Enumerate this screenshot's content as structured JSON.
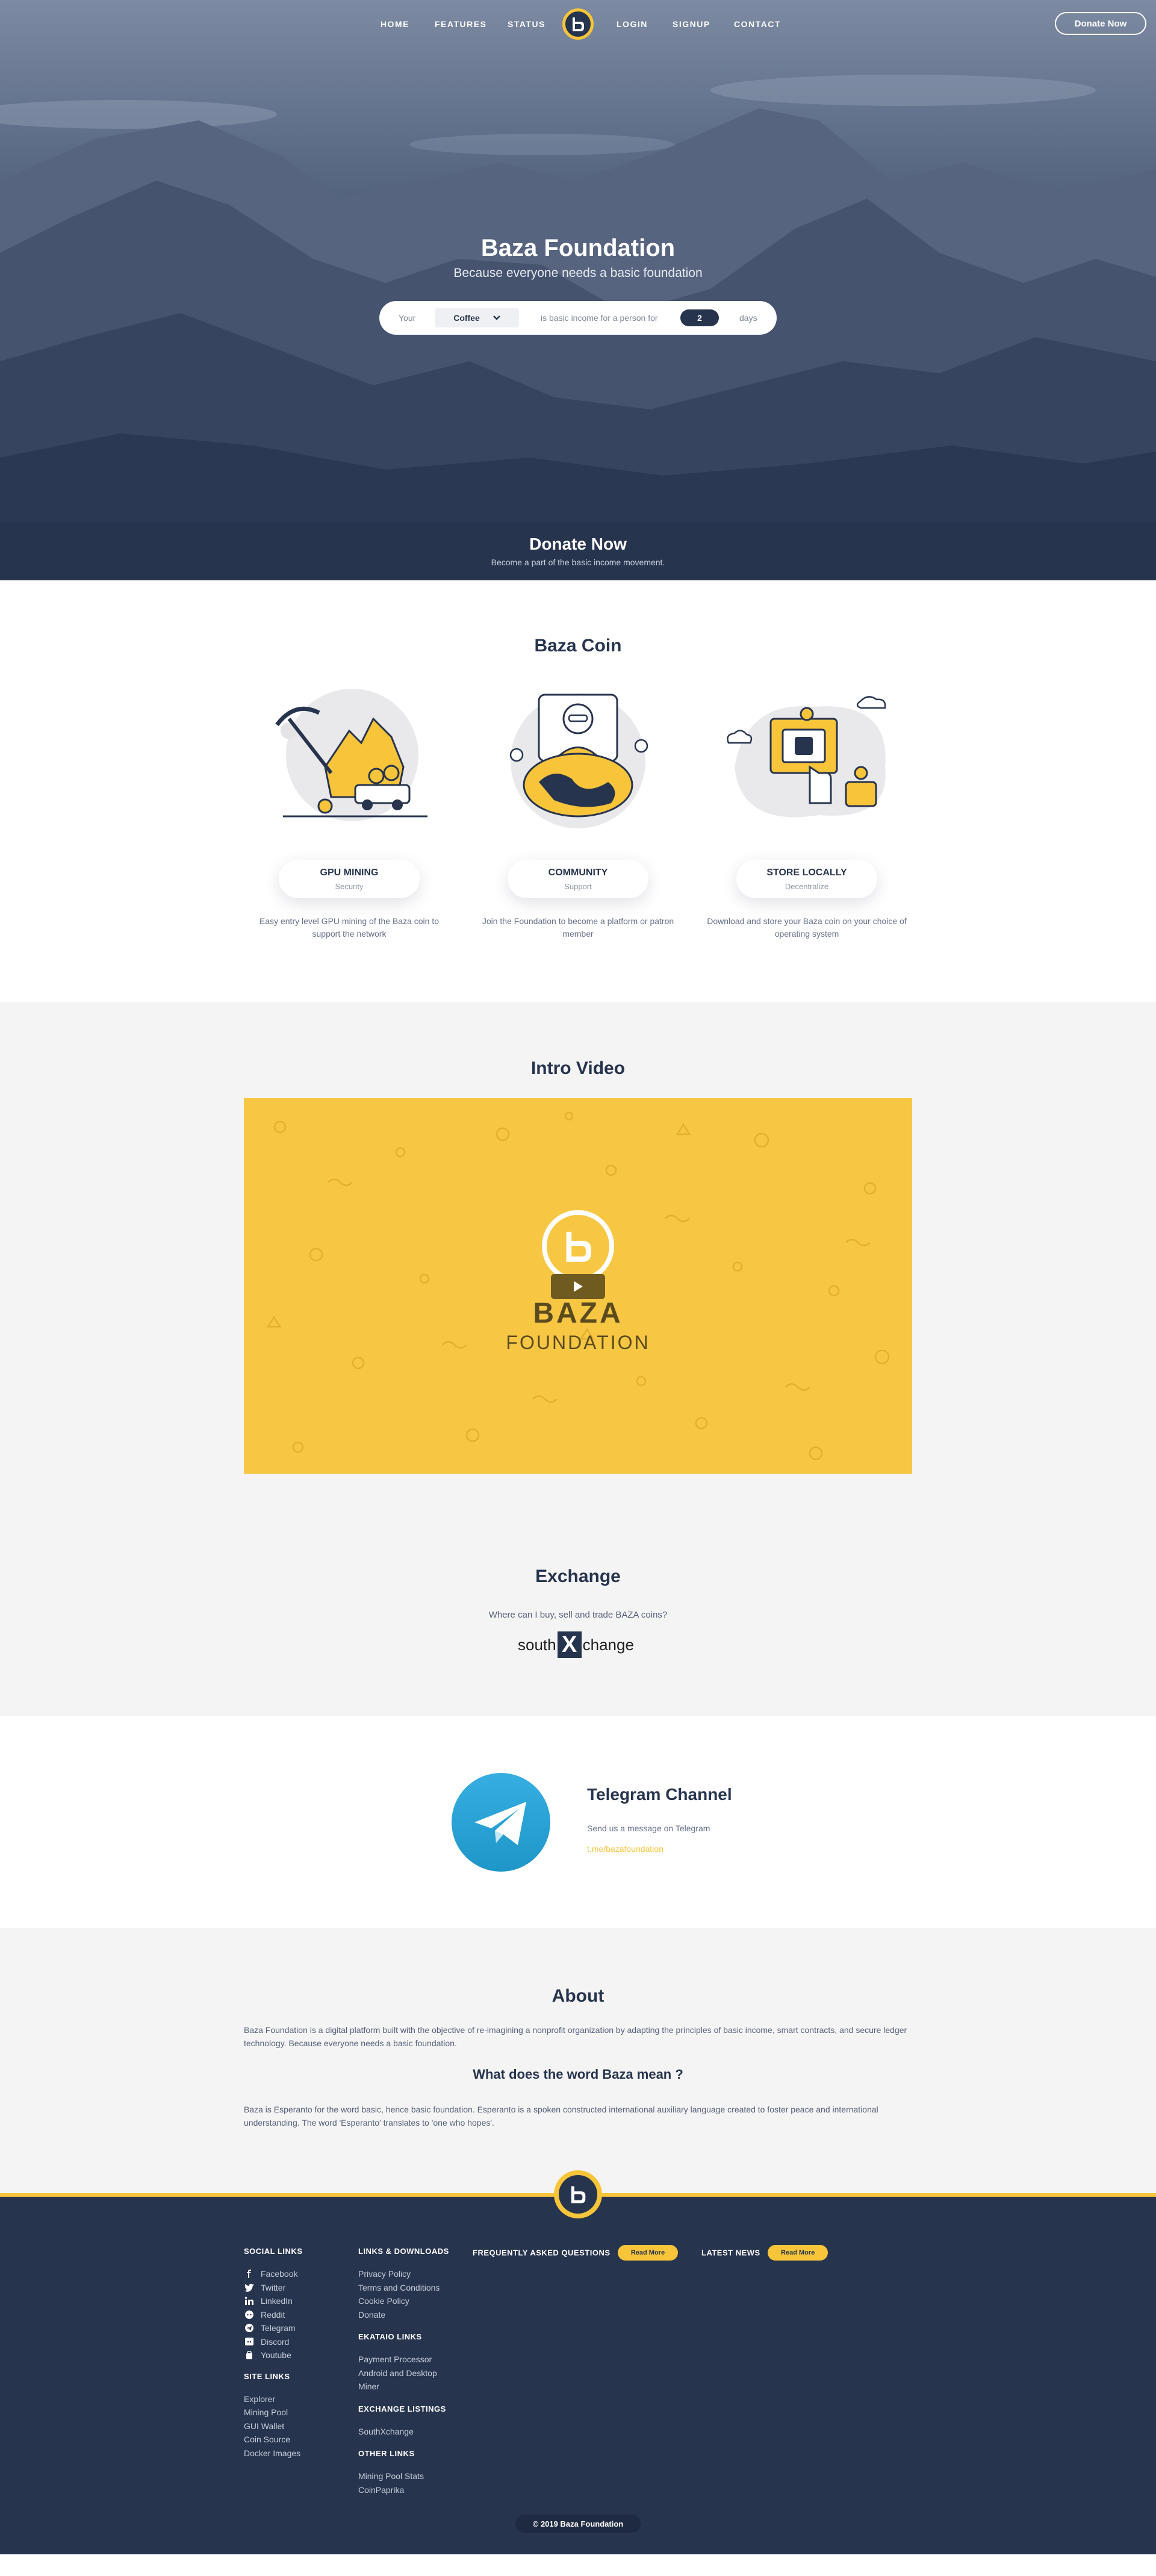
{
  "nav": {
    "links": [
      "HOME",
      "FEATURES",
      "STATUS",
      "LOGIN",
      "SIGNUP",
      "CONTACT"
    ],
    "logo": "b",
    "donate_button": "Donate Now"
  },
  "hero": {
    "title": "Baza Foundation",
    "subtitle": "Because everyone needs a basic foundation",
    "calc": {
      "prefix": "Your",
      "item_selected": "Coffee",
      "middle": "is basic income for a person for",
      "days_value": "2",
      "suffix": "days"
    }
  },
  "donate_band": {
    "title": "Donate Now",
    "subtitle": "Become a part of the basic income movement."
  },
  "coin": {
    "title": "Baza Coin",
    "features": [
      {
        "name": "GPU MINING",
        "sub": "Security",
        "desc": "Easy entry level GPU mining of the Baza coin to support the network"
      },
      {
        "name": "COMMUNITY",
        "sub": "Support",
        "desc": "Join the Foundation to become a platform or patron member"
      },
      {
        "name": "STORE LOCALLY",
        "sub": "Decentralize",
        "desc": "Download and store your Baza coin on your choice of operating system"
      }
    ]
  },
  "video": {
    "title": "Intro Video",
    "brand_top": "BAZA",
    "brand_bottom": "FOUNDATION"
  },
  "exchange": {
    "title": "Exchange",
    "question": "Where can I buy, sell and trade BAZA coins?",
    "logo_left": "south",
    "logo_x": "X",
    "logo_right": "change"
  },
  "telegram": {
    "title": "Telegram Channel",
    "text": "Send us a message on Telegram",
    "link": "t.me/bazafoundation"
  },
  "about": {
    "title": "About",
    "paragraph1": "Baza Foundation is a digital platform built with the objective of re-imagining a nonprofit organization by adapting the principles of basic income, smart contracts, and secure ledger technology. Because everyone needs a basic foundation.",
    "question": "What does the word Baza mean ?",
    "paragraph2": "Baza is Esperanto for the word basic, hence basic foundation. Esperanto is a spoken constructed international auxiliary language created to foster peace and international understanding. The word 'Esperanto' translates to 'one who hopes'."
  },
  "footer": {
    "social_title": "SOCIAL LINKS",
    "social": [
      {
        "label": "Facebook",
        "icon": "facebook-icon"
      },
      {
        "label": "Twitter",
        "icon": "twitter-icon"
      },
      {
        "label": "LinkedIn",
        "icon": "linkedin-icon"
      },
      {
        "label": "Reddit",
        "icon": "reddit-icon"
      },
      {
        "label": "Telegram",
        "icon": "telegram-icon"
      },
      {
        "label": "Discord",
        "icon": "discord-icon"
      },
      {
        "label": "Youtube",
        "icon": "youtube-icon"
      }
    ],
    "site_title": "SITE LINKS",
    "site": [
      "Explorer",
      "Mining Pool",
      "GUI Wallet",
      "Coin Source",
      "Docker Images"
    ],
    "downloads_title": "LINKS & DOWNLOADS",
    "downloads": [
      "Privacy Policy",
      "Terms and Conditions",
      "Cookie Policy",
      "Donate"
    ],
    "ekataio_title": "EKATAIO LINKS",
    "ekataio": [
      "Payment Processor",
      "Android and Desktop",
      "Miner"
    ],
    "listings_title": "EXCHANGE LISTINGS",
    "listings": [
      "SouthXchange"
    ],
    "other_title": "OTHER LINKS",
    "other": [
      "Mining Pool Stats",
      "CoinPaprika"
    ],
    "faq_title": "FREQUENTLY ASKED QUESTIONS",
    "news_title": "LATEST NEWS",
    "read_more": "Read More",
    "copyright": "© 2019 Baza Foundation"
  },
  "colors": {
    "navy": "#27344e",
    "yellow": "#f7c43a",
    "light_bg": "#f4f4f4"
  }
}
